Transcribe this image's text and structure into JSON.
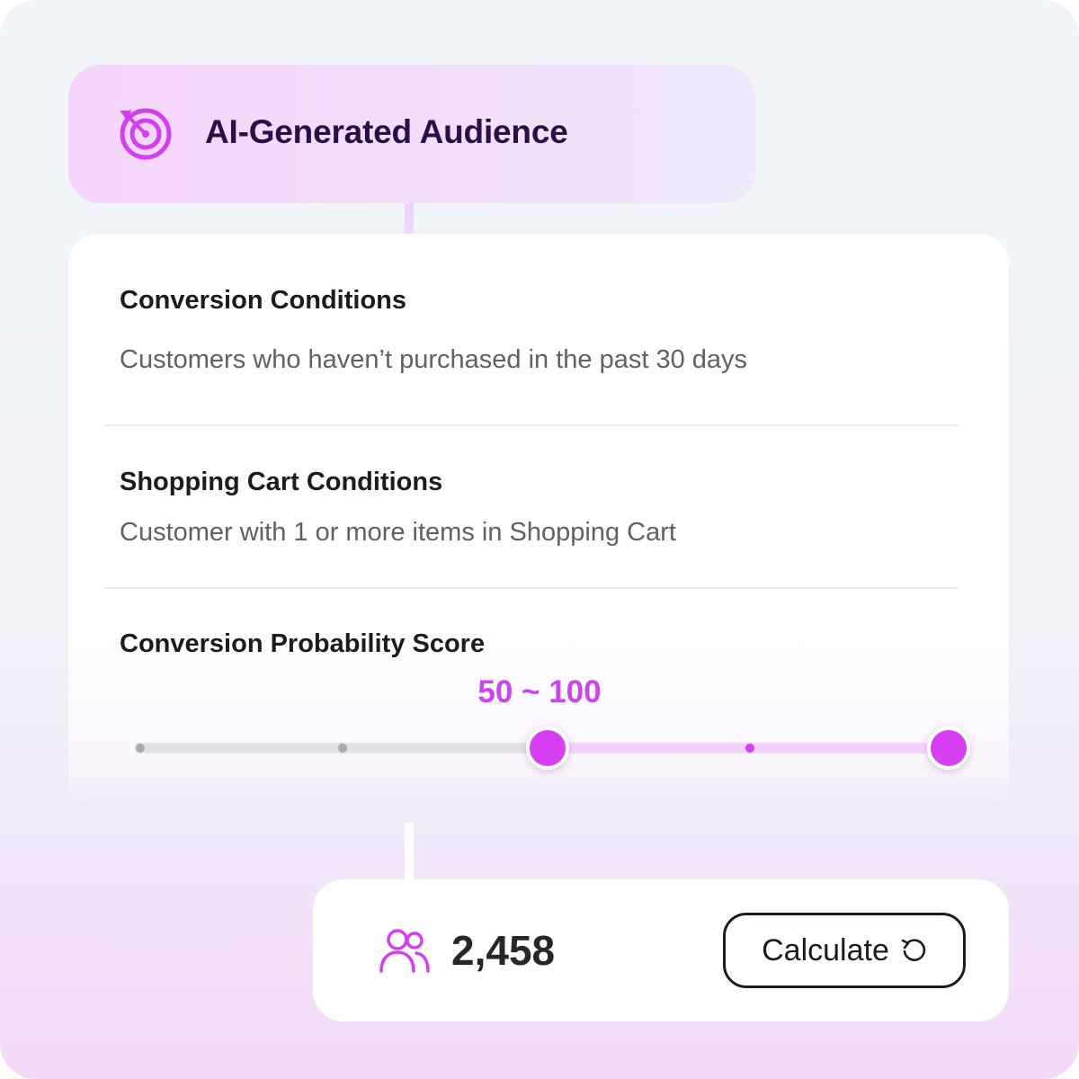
{
  "header": {
    "title": "AI-Generated Audience",
    "icon": "target-icon"
  },
  "conditions": {
    "conversion": {
      "title": "Conversion Conditions",
      "description": "Customers who haven’t purchased in the past 30 days"
    },
    "cart": {
      "title": "Shopping Cart Conditions",
      "description": "Customer with 1 or more items in Shopping Cart"
    },
    "score": {
      "title": "Conversion Probability Score",
      "range_label": "50 ~ 100",
      "min": 0,
      "max": 100,
      "selected_low": 50,
      "selected_high": 100
    }
  },
  "result": {
    "icon": "users-icon",
    "count": "2,458",
    "calculate_label": "Calculate",
    "calculate_icon": "refresh-icon"
  },
  "colors": {
    "accent": "#d63ff2",
    "accent_light": "#f4d3fb",
    "title_dark": "#2b0f47"
  }
}
